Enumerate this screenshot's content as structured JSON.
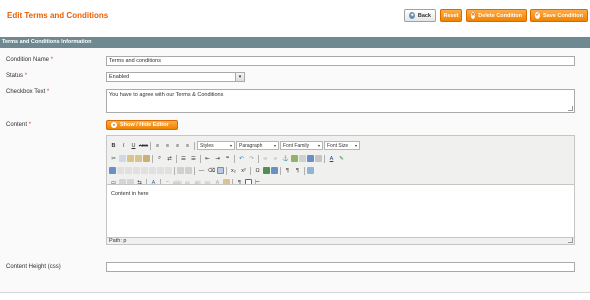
{
  "header": {
    "title": "Edit Terms and Conditions",
    "buttons": {
      "back": "Back",
      "reset": "Reset",
      "delete": "Delete Condition",
      "save": "Save Condition"
    }
  },
  "section": {
    "title": "Terms and Conditions Information"
  },
  "form": {
    "condition_name": {
      "label": "Condition Name",
      "required": "*",
      "value": "Terms and conditions"
    },
    "status": {
      "label": "Status",
      "required": "*",
      "value": "Enabled"
    },
    "checkbox_text": {
      "label": "Checkbox Text",
      "required": "*",
      "value": "You have to agree with our Terms & Conditions"
    },
    "content": {
      "label": "Content",
      "required": "*",
      "toggle_button": "Show / Hide Editor"
    },
    "content_height": {
      "label": "Content Height (css)",
      "value": ""
    }
  },
  "editor": {
    "dropdowns": {
      "styles": "Styles",
      "paragraph": "Paragraph",
      "font_family": "Font Family",
      "font_size": "Font Size"
    },
    "body_text": "Content in here",
    "path": "Path: p"
  },
  "colors": {
    "title": "#eb5e00",
    "accent_button": "#f18200",
    "section_bar": "#6f8992",
    "required": "#eb340a"
  }
}
